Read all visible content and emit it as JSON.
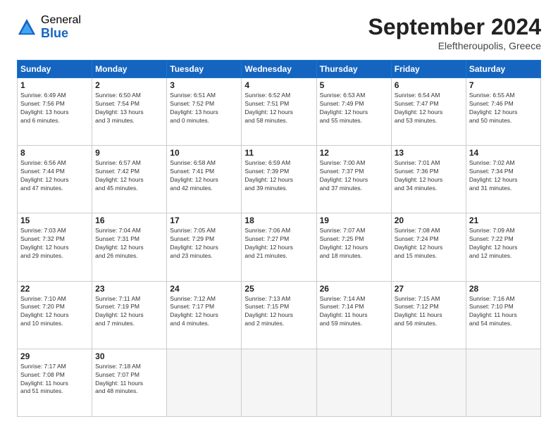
{
  "header": {
    "logo_general": "General",
    "logo_blue": "Blue",
    "month_title": "September 2024",
    "subtitle": "Eleftheroupolis, Greece"
  },
  "calendar": {
    "days_of_week": [
      "Sunday",
      "Monday",
      "Tuesday",
      "Wednesday",
      "Thursday",
      "Friday",
      "Saturday"
    ],
    "weeks": [
      [
        {
          "day": "1",
          "info": "Sunrise: 6:49 AM\nSunset: 7:56 PM\nDaylight: 13 hours\nand 6 minutes."
        },
        {
          "day": "2",
          "info": "Sunrise: 6:50 AM\nSunset: 7:54 PM\nDaylight: 13 hours\nand 3 minutes."
        },
        {
          "day": "3",
          "info": "Sunrise: 6:51 AM\nSunset: 7:52 PM\nDaylight: 13 hours\nand 0 minutes."
        },
        {
          "day": "4",
          "info": "Sunrise: 6:52 AM\nSunset: 7:51 PM\nDaylight: 12 hours\nand 58 minutes."
        },
        {
          "day": "5",
          "info": "Sunrise: 6:53 AM\nSunset: 7:49 PM\nDaylight: 12 hours\nand 55 minutes."
        },
        {
          "day": "6",
          "info": "Sunrise: 6:54 AM\nSunset: 7:47 PM\nDaylight: 12 hours\nand 53 minutes."
        },
        {
          "day": "7",
          "info": "Sunrise: 6:55 AM\nSunset: 7:46 PM\nDaylight: 12 hours\nand 50 minutes."
        }
      ],
      [
        {
          "day": "8",
          "info": "Sunrise: 6:56 AM\nSunset: 7:44 PM\nDaylight: 12 hours\nand 47 minutes."
        },
        {
          "day": "9",
          "info": "Sunrise: 6:57 AM\nSunset: 7:42 PM\nDaylight: 12 hours\nand 45 minutes."
        },
        {
          "day": "10",
          "info": "Sunrise: 6:58 AM\nSunset: 7:41 PM\nDaylight: 12 hours\nand 42 minutes."
        },
        {
          "day": "11",
          "info": "Sunrise: 6:59 AM\nSunset: 7:39 PM\nDaylight: 12 hours\nand 39 minutes."
        },
        {
          "day": "12",
          "info": "Sunrise: 7:00 AM\nSunset: 7:37 PM\nDaylight: 12 hours\nand 37 minutes."
        },
        {
          "day": "13",
          "info": "Sunrise: 7:01 AM\nSunset: 7:36 PM\nDaylight: 12 hours\nand 34 minutes."
        },
        {
          "day": "14",
          "info": "Sunrise: 7:02 AM\nSunset: 7:34 PM\nDaylight: 12 hours\nand 31 minutes."
        }
      ],
      [
        {
          "day": "15",
          "info": "Sunrise: 7:03 AM\nSunset: 7:32 PM\nDaylight: 12 hours\nand 29 minutes."
        },
        {
          "day": "16",
          "info": "Sunrise: 7:04 AM\nSunset: 7:31 PM\nDaylight: 12 hours\nand 26 minutes."
        },
        {
          "day": "17",
          "info": "Sunrise: 7:05 AM\nSunset: 7:29 PM\nDaylight: 12 hours\nand 23 minutes."
        },
        {
          "day": "18",
          "info": "Sunrise: 7:06 AM\nSunset: 7:27 PM\nDaylight: 12 hours\nand 21 minutes."
        },
        {
          "day": "19",
          "info": "Sunrise: 7:07 AM\nSunset: 7:25 PM\nDaylight: 12 hours\nand 18 minutes."
        },
        {
          "day": "20",
          "info": "Sunrise: 7:08 AM\nSunset: 7:24 PM\nDaylight: 12 hours\nand 15 minutes."
        },
        {
          "day": "21",
          "info": "Sunrise: 7:09 AM\nSunset: 7:22 PM\nDaylight: 12 hours\nand 12 minutes."
        }
      ],
      [
        {
          "day": "22",
          "info": "Sunrise: 7:10 AM\nSunset: 7:20 PM\nDaylight: 12 hours\nand 10 minutes."
        },
        {
          "day": "23",
          "info": "Sunrise: 7:11 AM\nSunset: 7:19 PM\nDaylight: 12 hours\nand 7 minutes."
        },
        {
          "day": "24",
          "info": "Sunrise: 7:12 AM\nSunset: 7:17 PM\nDaylight: 12 hours\nand 4 minutes."
        },
        {
          "day": "25",
          "info": "Sunrise: 7:13 AM\nSunset: 7:15 PM\nDaylight: 12 hours\nand 2 minutes."
        },
        {
          "day": "26",
          "info": "Sunrise: 7:14 AM\nSunset: 7:14 PM\nDaylight: 11 hours\nand 59 minutes."
        },
        {
          "day": "27",
          "info": "Sunrise: 7:15 AM\nSunset: 7:12 PM\nDaylight: 11 hours\nand 56 minutes."
        },
        {
          "day": "28",
          "info": "Sunrise: 7:16 AM\nSunset: 7:10 PM\nDaylight: 11 hours\nand 54 minutes."
        }
      ],
      [
        {
          "day": "29",
          "info": "Sunrise: 7:17 AM\nSunset: 7:08 PM\nDaylight: 11 hours\nand 51 minutes."
        },
        {
          "day": "30",
          "info": "Sunrise: 7:18 AM\nSunset: 7:07 PM\nDaylight: 11 hours\nand 48 minutes."
        },
        {
          "day": "",
          "info": ""
        },
        {
          "day": "",
          "info": ""
        },
        {
          "day": "",
          "info": ""
        },
        {
          "day": "",
          "info": ""
        },
        {
          "day": "",
          "info": ""
        }
      ]
    ]
  }
}
